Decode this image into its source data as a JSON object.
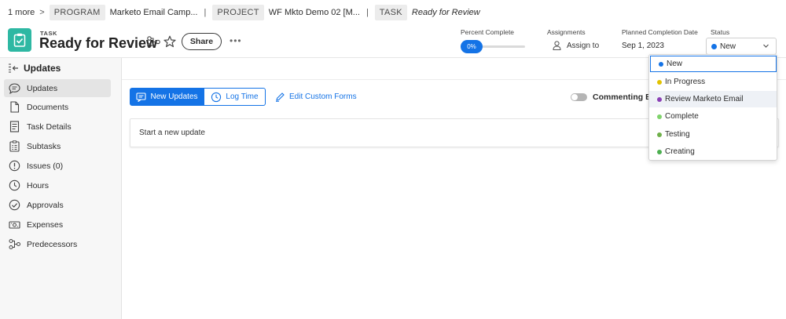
{
  "breadcrumb": {
    "more": "1 more",
    "arrow": ">",
    "program_tag": "PROGRAM",
    "program_name": "Marketo Email Camp...",
    "sep1": "|",
    "project_tag": "PROJECT",
    "project_name": "WF Mkto Demo 02 [M...",
    "sep2": "|",
    "task_tag": "TASK",
    "task_name": "Ready for Review"
  },
  "header": {
    "type_label": "TASK",
    "title": "Ready for Review",
    "share_label": "Share",
    "more_label": "•••",
    "percent_complete_label": "Percent Complete",
    "percent_complete_value": "0%",
    "percent_complete_fraction": 0,
    "assignments_label": "Assignments",
    "assign_to_label": "Assign to",
    "planned_completion_label": "Planned Completion Date",
    "planned_completion_value": "Sep 1, 2023",
    "status_label": "Status",
    "status_value": "New",
    "status_color": "#1473e6",
    "task_icon_color": "#2eb8a3"
  },
  "sidebar": {
    "title": "Updates",
    "items": [
      {
        "label": "Updates",
        "icon": "speech-bubble-icon"
      },
      {
        "label": "Documents",
        "icon": "document-icon"
      },
      {
        "label": "Task Details",
        "icon": "details-icon"
      },
      {
        "label": "Subtasks",
        "icon": "subtasks-icon"
      },
      {
        "label": "Issues (0)",
        "icon": "issues-icon"
      },
      {
        "label": "Hours",
        "icon": "clock-icon"
      },
      {
        "label": "Approvals",
        "icon": "approval-check-icon"
      },
      {
        "label": "Expenses",
        "icon": "expenses-icon"
      },
      {
        "label": "Predecessors",
        "icon": "predecessors-icon"
      }
    ]
  },
  "main": {
    "new_updates_tab": "New Updates",
    "log_time_tab": "Log Time",
    "edit_custom_forms": "Edit Custom Forms",
    "commenting_label": "Commenting Bet",
    "update_placeholder": "Start a new update",
    "accent_color": "#1473e6"
  },
  "status_dropdown": {
    "options": [
      {
        "label": "New",
        "color": "#1473e6"
      },
      {
        "label": "In Progress",
        "color": "#e2c200"
      },
      {
        "label": "Review Marketo Email",
        "color": "#8a3fb5"
      },
      {
        "label": "Complete",
        "color": "#7fd36b"
      },
      {
        "label": "Testing",
        "color": "#6fb04a"
      },
      {
        "label": "Creating",
        "color": "#4caf50"
      }
    ]
  }
}
